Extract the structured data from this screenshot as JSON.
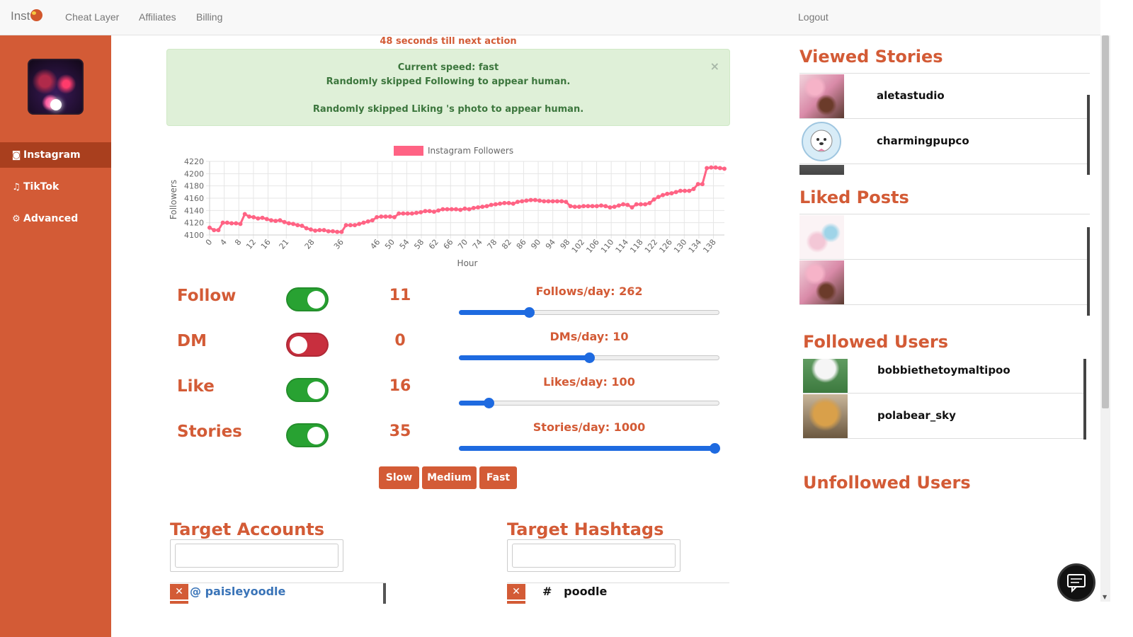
{
  "nav": {
    "brand": "Inst",
    "links": [
      "Cheat Layer",
      "Affiliates",
      "Billing"
    ],
    "logout": "Logout"
  },
  "sidebar": {
    "items": [
      {
        "label": "Instagram",
        "icon": "camera-icon"
      },
      {
        "label": "TikTok",
        "icon": "music-note-icon"
      },
      {
        "label": "Advanced",
        "icon": "gears-icon"
      }
    ]
  },
  "countdown": "48 seconds till next action",
  "alert": {
    "line1": "Current speed: fast",
    "line2": "Randomly skipped Following to appear human.",
    "line3": "Randomly skipped Liking 's photo to appear human.",
    "close": "×"
  },
  "chart_data": {
    "type": "line",
    "legend": "Instagram Followers",
    "xlabel": "Hour",
    "ylabel": "Followers",
    "ylim": [
      4100,
      4220
    ],
    "yticks": [
      4100,
      4120,
      4140,
      4160,
      4180,
      4200,
      4220
    ],
    "xticks": [
      0,
      4,
      8,
      12,
      16,
      21,
      28,
      36,
      46,
      50,
      54,
      58,
      62,
      66,
      70,
      74,
      78,
      82,
      86,
      90,
      94,
      98,
      102,
      106,
      110,
      114,
      118,
      122,
      126,
      130,
      134,
      138
    ],
    "grid": true,
    "color": "#ff6384",
    "values": [
      4112,
      4108,
      4108,
      4120,
      4120,
      4119,
      4119,
      4118,
      4134,
      4130,
      4129,
      4127,
      4128,
      4126,
      4124,
      4123,
      4124,
      4121,
      4119,
      4118,
      4116,
      4115,
      4111,
      4109,
      4107,
      4108,
      4108,
      4106,
      4106,
      4105,
      4105,
      4116,
      4116,
      4116,
      4118,
      4120,
      4122,
      4124,
      4129,
      4130,
      4130,
      4130,
      4129,
      4135,
      4135,
      4135,
      4135,
      4136,
      4137,
      4139,
      4139,
      4138,
      4140,
      4142,
      4142,
      4142,
      4142,
      4141,
      4143,
      4142,
      4144,
      4145,
      4146,
      4147,
      4149,
      4150,
      4151,
      4152,
      4152,
      4151,
      4154,
      4155,
      4156,
      4157,
      4157,
      4156,
      4155,
      4155,
      4155,
      4155,
      4155,
      4154,
      4147,
      4146,
      4146,
      4147,
      4147,
      4147,
      4147,
      4148,
      4147,
      4145,
      4146,
      4148,
      4150,
      4149,
      4145,
      4150,
      4150,
      4150,
      4152,
      4158,
      4162,
      4165,
      4167,
      4168,
      4170,
      4172,
      4172,
      4172,
      4175,
      4183,
      4183,
      4209,
      4210,
      4210,
      4209,
      4208
    ]
  },
  "controls": [
    {
      "name": "Follow",
      "on": true,
      "count": "11",
      "rate": "Follows/day: 262",
      "slider": 0.27
    },
    {
      "name": "DM",
      "on": false,
      "count": "0",
      "rate": "DMs/day: 10",
      "slider": 0.5
    },
    {
      "name": "Like",
      "on": true,
      "count": "16",
      "rate": "Likes/day: 100",
      "slider": 0.115
    },
    {
      "name": "Stories",
      "on": true,
      "count": "35",
      "rate": "Stories/day: 1000",
      "slider": 0.98
    }
  ],
  "speed_buttons": [
    "Slow",
    "Medium",
    "Fast"
  ],
  "targets": {
    "accounts_title": "Target Accounts",
    "accounts": [
      "@ paisleyoodle"
    ],
    "hashtags_title": "Target Hashtags",
    "hashtags": [
      "#   poodle"
    ]
  },
  "viewed_stories": {
    "title": "Viewed Stories",
    "items": [
      "aletastudio",
      "charmingpupco"
    ]
  },
  "liked_posts": {
    "title": "Liked Posts"
  },
  "followed_users": {
    "title": "Followed Users",
    "items": [
      "bobbiethetoymaltipoo",
      "polabear_sky"
    ]
  },
  "unfollowed_users": {
    "title": "Unfollowed Users"
  }
}
